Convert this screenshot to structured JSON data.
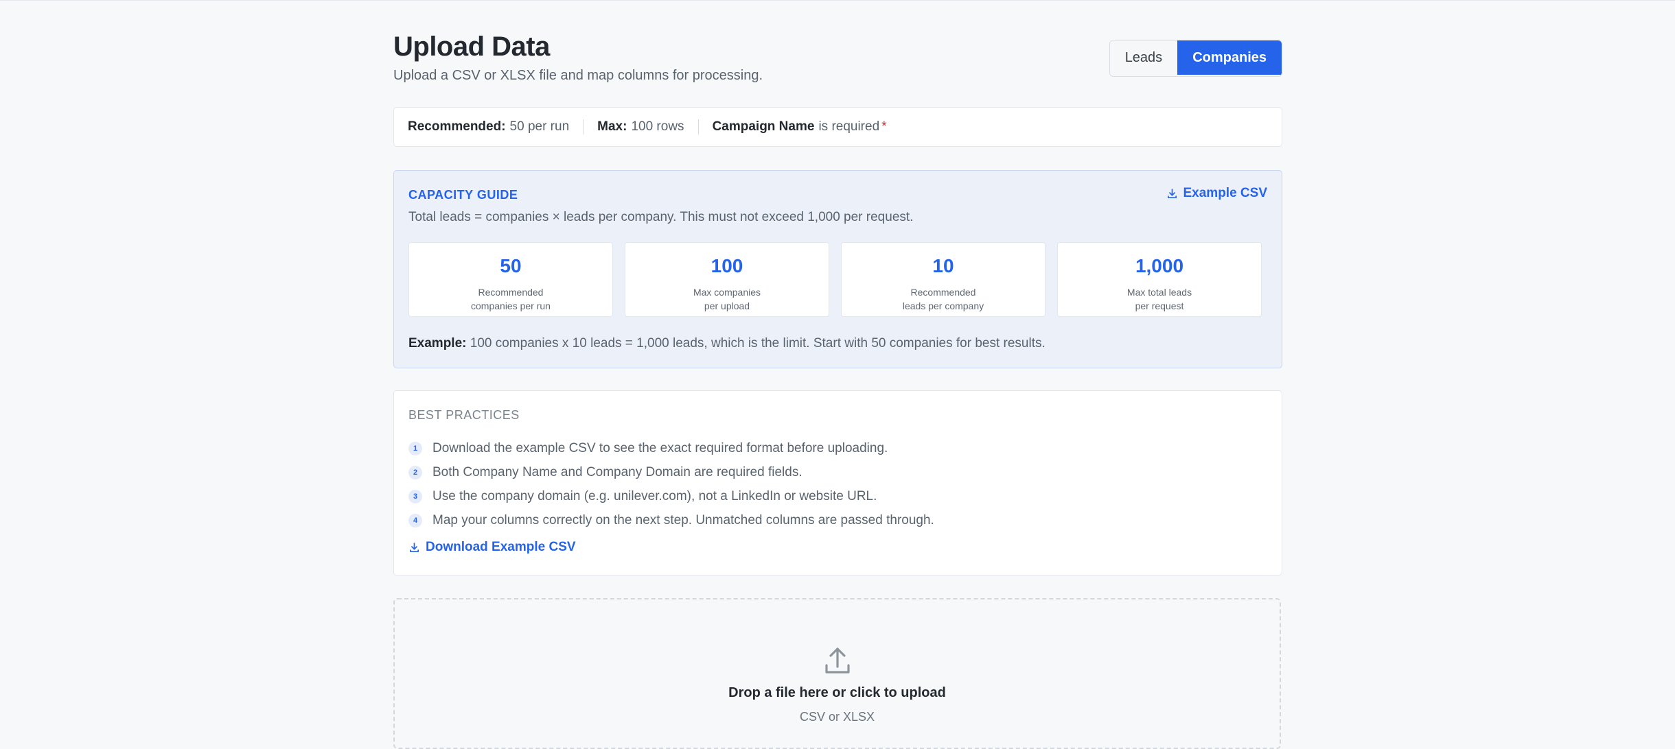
{
  "header": {
    "title": "Upload Data",
    "subtitle": "Upload a CSV or XLSX file and map columns for processing."
  },
  "toggle": {
    "options": [
      "Leads",
      "Companies"
    ],
    "selected": "Companies"
  },
  "limits": {
    "recommended_label": "Recommended:",
    "recommended_value": "50 per run",
    "max_label": "Max:",
    "max_value": "100 rows",
    "campaign_label": "Campaign Name",
    "campaign_text": "is required",
    "required_mark": "*"
  },
  "capacity": {
    "title": "CAPACITY GUIDE",
    "link": "Example CSV",
    "description": "Total leads = companies × leads per company. This must not exceed 1,000 per request.",
    "stats": [
      {
        "value": "50",
        "label": "Recommended\ncompanies per run"
      },
      {
        "value": "100",
        "label": "Max companies\nper upload"
      },
      {
        "value": "10",
        "label": "Recommended\nleads per company"
      },
      {
        "value": "1,000",
        "label": "Max total leads\nper request"
      }
    ],
    "example_label": "Example:",
    "example_text": "100 companies x 10 leads = 1,000 leads, which is the limit. Start with 50 companies for best results."
  },
  "practices": {
    "title": "BEST PRACTICES",
    "items": [
      {
        "num": "1",
        "text": "Download the example CSV to see the exact required format before uploading."
      },
      {
        "num": "2",
        "text": "Both Company Name and Company Domain are required fields."
      },
      {
        "num": "3",
        "text": "Use the company domain (e.g. unilever.com), not a LinkedIn or website URL."
      },
      {
        "num": "4",
        "text": "Map your columns correctly on the next step. Unmatched columns are passed through."
      }
    ],
    "download_link": "Download Example CSV"
  },
  "upload": {
    "title": "Drop a file here or click to upload",
    "subtitle": "CSV or XLSX"
  },
  "colors": {
    "accent": "#2563eb",
    "required": "#dc2626"
  },
  "icons": {
    "download": "download-icon",
    "upload": "upload-icon"
  }
}
